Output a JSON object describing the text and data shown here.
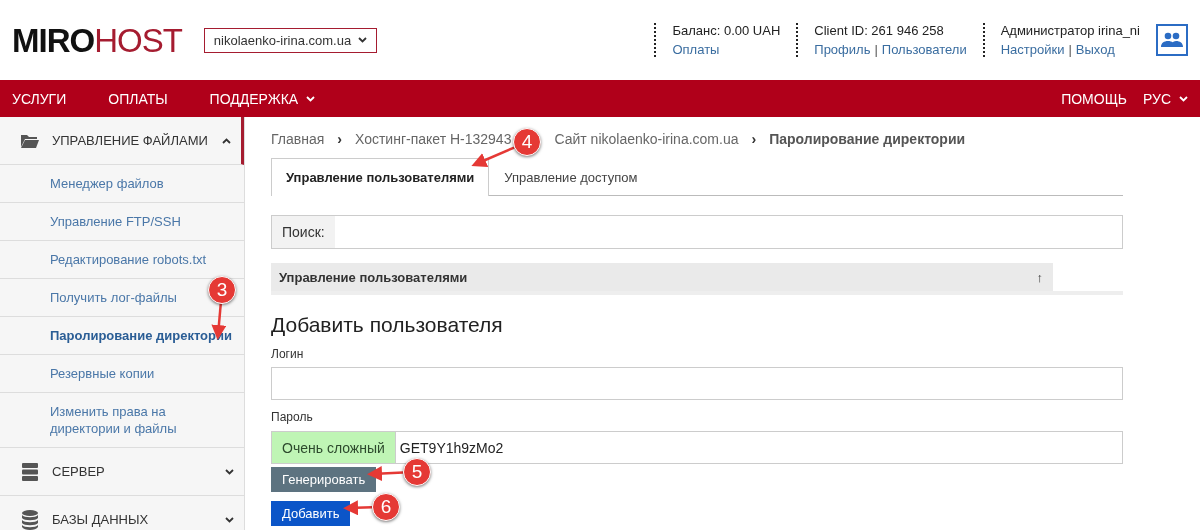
{
  "header": {
    "logo": {
      "dark": "MIRO",
      "accent": "HOST"
    },
    "site_select": "nikolaenko-irina.com.ua",
    "info": [
      {
        "title": "Баланс: 0.00 UAH",
        "links": [
          "Оплаты"
        ]
      },
      {
        "title": "Client ID: 261 946 258",
        "links": [
          "Профиль",
          "Пользователи"
        ]
      },
      {
        "title": "Администратор irina_ni",
        "links": [
          "Настройки",
          "Выход"
        ]
      }
    ],
    "link_separator": "|"
  },
  "nav": {
    "left": [
      {
        "label": "УСЛУГИ",
        "dropdown": false
      },
      {
        "label": "ОПЛАТЫ",
        "dropdown": false
      },
      {
        "label": "ПОДДЕРЖКА",
        "dropdown": true
      }
    ],
    "right": [
      {
        "label": "ПОМОЩЬ",
        "dropdown": false
      },
      {
        "label": "РУС",
        "dropdown": true
      }
    ]
  },
  "sidebar": {
    "sections": [
      {
        "label": "УПРАВЛЕНИЕ ФАЙЛАМИ",
        "expanded": true,
        "children": [
          {
            "label": "Менеджер файлов",
            "selected": false
          },
          {
            "label": "Управление FTP/SSH",
            "selected": false
          },
          {
            "label": "Редактирование robots.txt",
            "selected": false
          },
          {
            "label": "Получить лог-файлы",
            "selected": false
          },
          {
            "label": "Паролирование директории",
            "selected": true
          },
          {
            "label": "Резервные копии",
            "selected": false
          },
          {
            "label": "Изменить права на директории и файлы",
            "selected": false
          }
        ]
      },
      {
        "label": "СЕРВЕР",
        "expanded": false
      },
      {
        "label": "БАЗЫ ДАННЫХ",
        "expanded": false
      }
    ]
  },
  "breadcrumb": [
    {
      "kind": "link",
      "text": "Главная"
    },
    {
      "kind": "separator",
      "text": "›"
    },
    {
      "kind": "link",
      "text": "Хостинг-пакет Н-132943"
    },
    {
      "kind": "link",
      "text": "Сайт nikolaenko-irina.com.ua"
    },
    {
      "kind": "separator",
      "text": "›"
    },
    {
      "kind": "current",
      "text": "Паролирование директории"
    }
  ],
  "tabs": [
    {
      "label": "Управление пользователями",
      "selected": true
    },
    {
      "label": "Управление доступом",
      "selected": false
    }
  ],
  "search": {
    "label": "Поиск:"
  },
  "table": {
    "columns": [
      {
        "label": "Управление пользователями",
        "sort": "↑"
      }
    ]
  },
  "form": {
    "title": "Добавить пользователя",
    "login_label": "Логин",
    "password_label": "Пароль",
    "strength": "Очень сложный",
    "password": "GET9Y1h9zMo2",
    "generate_button": "Генерировать",
    "add_button": "Добавить"
  },
  "annotations": [
    {
      "number": "3"
    },
    {
      "number": "4"
    },
    {
      "number": "5"
    },
    {
      "number": "6"
    }
  ]
}
